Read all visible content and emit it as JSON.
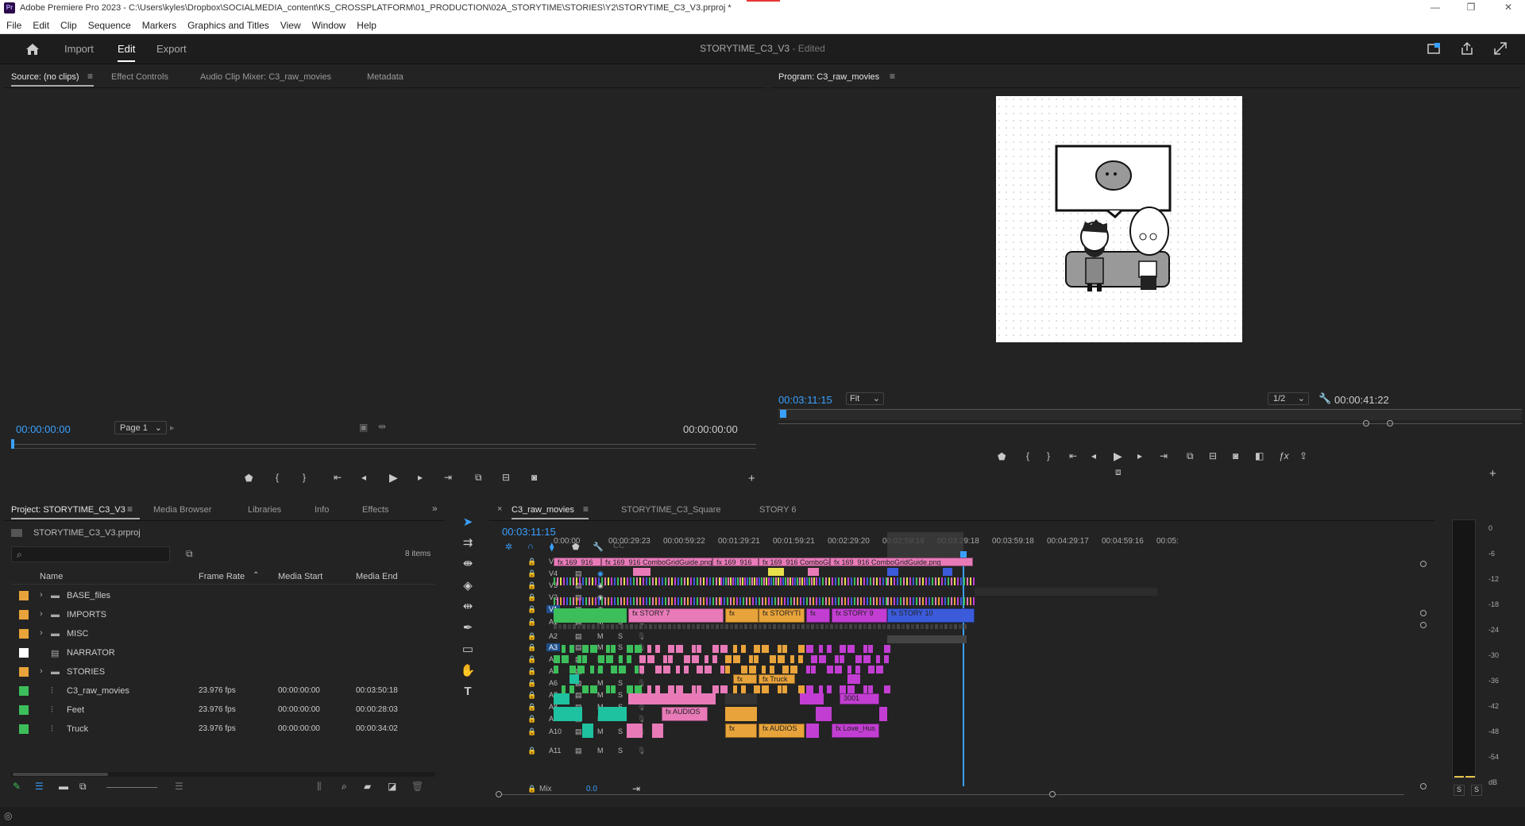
{
  "app": {
    "title": "Adobe Premiere Pro 2023 - C:\\Users\\kyles\\Dropbox\\SOCIALMEDIA_content\\KS_CROSSPLATFORM\\01_PRODUCTION\\02A_STORYTIME\\STORIES\\Y2\\STORYTIME_C3_V3.prproj *",
    "logo": "Pr",
    "minimize": "—",
    "restore": "❐",
    "close": "✕"
  },
  "menu": [
    "File",
    "Edit",
    "Clip",
    "Sequence",
    "Markers",
    "Graphics and Titles",
    "View",
    "Window",
    "Help"
  ],
  "header": {
    "home_icon": "home-icon",
    "tabs": [
      "Import",
      "Edit",
      "Export"
    ],
    "active_tab": "Edit",
    "project_title": "STORYTIME_C3_V3",
    "edited": " - Edited"
  },
  "source": {
    "tabs": [
      "Source: (no clips)",
      "Effect Controls",
      "Audio Clip Mixer: C3_raw_movies",
      "Metadata"
    ],
    "timecode_in": "00:00:00:00",
    "page": "Page 1",
    "timecode_out": "00:00:00:00"
  },
  "program": {
    "title": "Program: C3_raw_movies",
    "timecode": "00:03:11:15",
    "fit": "Fit",
    "resolution": "1/2",
    "duration": "00:00:41:22"
  },
  "project": {
    "tabs": [
      "Project: STORYTIME_C3_V3",
      "Media Browser",
      "Libraries",
      "Info",
      "Effects"
    ],
    "file": "STORYTIME_C3_V3.prproj",
    "item_count": "8 items",
    "columns": [
      "Name",
      "Frame Rate",
      "Media Start",
      "Media End"
    ],
    "items": [
      {
        "name": "BASE_files",
        "type": "folder",
        "color": "#e8a33a",
        "fps": "",
        "start": "",
        "end": ""
      },
      {
        "name": "IMPORTS",
        "type": "folder",
        "color": "#e8a33a",
        "fps": "",
        "start": "",
        "end": ""
      },
      {
        "name": "MISC",
        "type": "folder",
        "color": "#e8a33a",
        "fps": "",
        "start": "",
        "end": ""
      },
      {
        "name": "NARRATOR",
        "type": "file",
        "color": "#ffffff",
        "fps": "",
        "start": "",
        "end": ""
      },
      {
        "name": "STORIES",
        "type": "folder",
        "color": "#e8a33a",
        "fps": "",
        "start": "",
        "end": ""
      },
      {
        "name": "C3_raw_movies",
        "type": "sequence",
        "color": "#3cbf5a",
        "fps": "23.976 fps",
        "start": "00:00:00:00",
        "end": "00:03:50:18"
      },
      {
        "name": "Feet",
        "type": "sequence",
        "color": "#3cbf5a",
        "fps": "23.976 fps",
        "start": "00:00:00:00",
        "end": "00:00:28:03"
      },
      {
        "name": "Truck",
        "type": "sequence",
        "color": "#3cbf5a",
        "fps": "23.976 fps",
        "start": "00:00:00:00",
        "end": "00:00:34:02"
      }
    ]
  },
  "timeline": {
    "tabs": [
      "C3_raw_movies",
      "STORYTIME_C3_Square",
      "STORY 6"
    ],
    "timecode": "00:03:11:15",
    "ruler": [
      "0:00:00",
      "00:00:29:23",
      "00:00:59:22",
      "00:01:29:21",
      "00:01:59:21",
      "00:02:29:20",
      "00:02:59:19",
      "00:03:29:18",
      "00:03:59:18",
      "00:04:29:17",
      "00:04:59:16",
      "00:05:"
    ],
    "video_tracks": [
      "V5",
      "V4",
      "V3",
      "V2",
      "V1"
    ],
    "audio_tracks": [
      "A1",
      "A2",
      "A3",
      "A4",
      "A5",
      "A6",
      "A7",
      "A8",
      "A9",
      "A10",
      "A11"
    ],
    "mix_label": "Mix",
    "mix_value": "0.0",
    "clip_labels": {
      "v5a": "169_916",
      "v5b": "169_916 ComboGridGuide.png",
      "v5c": "169_916",
      "v5d": "169_916 ComboGrid",
      "v5e": "169_916 ComboGridGuide.png",
      "a1a": "STORY 7",
      "a1b": "STORYTI",
      "a1c": "STORY 9",
      "a1d": "STORY 10",
      "a7": "Truck",
      "a9": "3001",
      "a10": "AUDIOS",
      "a11a": "AUDIOS",
      "a11b": "Love_Hus",
      "fx": "fx"
    }
  },
  "meters": {
    "labels": [
      "0",
      "-6",
      "-12",
      "-18",
      "-24",
      "-30",
      "-36",
      "-42",
      "-48",
      "-54",
      "dB"
    ],
    "solo": [
      "S",
      "S"
    ]
  },
  "colors": {
    "accent": "#3aa0ff",
    "pink": "#e87ab8",
    "magenta": "#c23ed2",
    "orange": "#e8a33a",
    "green": "#3cbf5a",
    "blue": "#3b5bdb",
    "teal": "#1fc2a0",
    "yellow": "#e6e04a"
  }
}
